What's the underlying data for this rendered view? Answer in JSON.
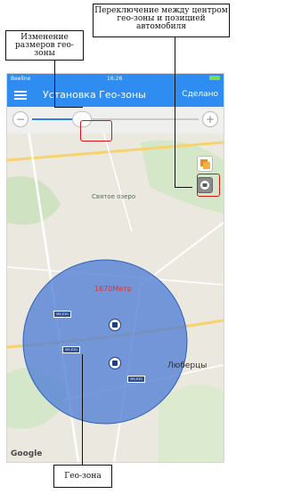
{
  "callouts": {
    "resize": "Изменение размеров гео-зоны",
    "switch": "Переключение между центром гео-зоны и позицией автомобиля",
    "zone": "Гео-зона"
  },
  "statusbar": {
    "carrier": "Beeline",
    "time": "16:26"
  },
  "navbar": {
    "title": "Установка Гео-зоны",
    "done_label": "Сделано"
  },
  "slider": {
    "value_fraction": 0.3
  },
  "map": {
    "distance_label": "1670Метр",
    "town_label": "Люберцы",
    "lake_label": "Святое озеро",
    "attribution": "Google",
    "road_shields": [
      "M5-E30",
      "M5-E30",
      "M5-E30"
    ]
  },
  "colors": {
    "accent": "#2f8cf0",
    "geofence_fill": "#4f7fd6",
    "highlight": "#d9141b"
  }
}
